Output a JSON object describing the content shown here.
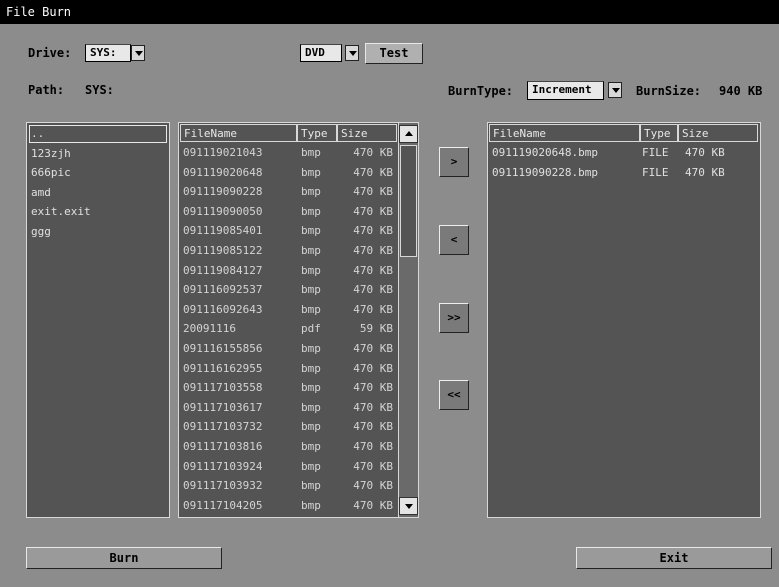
{
  "window": {
    "title": "File Burn"
  },
  "drive": {
    "label": "Drive:",
    "value": "SYS:"
  },
  "device": {
    "value": "DVD",
    "test_label": "Test"
  },
  "path": {
    "label": "Path:",
    "value": "SYS:"
  },
  "burn": {
    "type_label": "BurnType:",
    "type_value": "Increment",
    "size_label": "BurnSize:",
    "size_value": "940 KB"
  },
  "folders": [
    "..",
    "123zjh",
    "666pic",
    "amd",
    "exit.exit",
    "ggg"
  ],
  "source": {
    "headers": {
      "name": "FileName",
      "type": "Type",
      "size": "Size"
    },
    "rows": [
      {
        "name": "091119021043",
        "type": "bmp",
        "size": "470 KB"
      },
      {
        "name": "091119020648",
        "type": "bmp",
        "size": "470 KB"
      },
      {
        "name": "091119090228",
        "type": "bmp",
        "size": "470 KB"
      },
      {
        "name": "091119090050",
        "type": "bmp",
        "size": "470 KB"
      },
      {
        "name": "091119085401",
        "type": "bmp",
        "size": "470 KB"
      },
      {
        "name": "091119085122",
        "type": "bmp",
        "size": "470 KB"
      },
      {
        "name": "091119084127",
        "type": "bmp",
        "size": "470 KB"
      },
      {
        "name": "091116092537",
        "type": "bmp",
        "size": "470 KB"
      },
      {
        "name": "091116092643",
        "type": "bmp",
        "size": "470 KB"
      },
      {
        "name": "20091116",
        "type": "pdf",
        "size": "59 KB"
      },
      {
        "name": "091116155856",
        "type": "bmp",
        "size": "470 KB"
      },
      {
        "name": "091116162955",
        "type": "bmp",
        "size": "470 KB"
      },
      {
        "name": "091117103558",
        "type": "bmp",
        "size": "470 KB"
      },
      {
        "name": "091117103617",
        "type": "bmp",
        "size": "470 KB"
      },
      {
        "name": "091117103732",
        "type": "bmp",
        "size": "470 KB"
      },
      {
        "name": "091117103816",
        "type": "bmp",
        "size": "470 KB"
      },
      {
        "name": "091117103924",
        "type": "bmp",
        "size": "470 KB"
      },
      {
        "name": "091117103932",
        "type": "bmp",
        "size": "470 KB"
      },
      {
        "name": "091117104205",
        "type": "bmp",
        "size": "470 KB"
      }
    ]
  },
  "move": {
    "add": ">",
    "remove": "<",
    "add_all": ">>",
    "remove_all": "<<"
  },
  "target": {
    "headers": {
      "name": "FileName",
      "type": "Type",
      "size": "Size"
    },
    "rows": [
      {
        "name": "091119020648.bmp",
        "type": "FILE",
        "size": "470 KB"
      },
      {
        "name": "091119090228.bmp",
        "type": "FILE",
        "size": "470 KB"
      }
    ]
  },
  "actions": {
    "burn": "Burn",
    "exit": "Exit"
  },
  "icons": {
    "dropdown": "chevron-down-icon",
    "scroll_up": "arrow-up-icon",
    "scroll_down": "arrow-down-icon"
  }
}
